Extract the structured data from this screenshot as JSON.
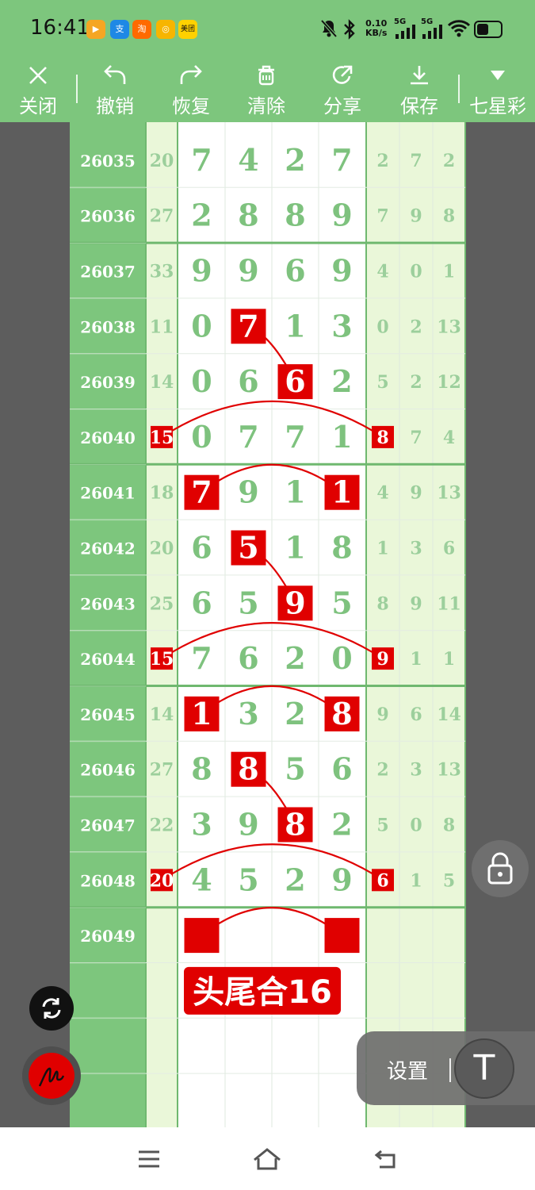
{
  "status": {
    "time": "16:41",
    "app_icons": [
      {
        "name": "video-app-icon",
        "text": "▶",
        "color": "#f5a623"
      },
      {
        "name": "alipay-app-icon",
        "text": "支",
        "color": "#1e88e5"
      },
      {
        "name": "taobao-app-icon",
        "text": "淘",
        "color": "#ff6a00"
      },
      {
        "name": "coin-app-icon",
        "text": "◎",
        "color": "#f7b500"
      },
      {
        "name": "meituan-app-icon",
        "text": "美团",
        "color": "#ffd100"
      }
    ],
    "net_speed_value": "0.10",
    "net_speed_unit": "KB/s",
    "signal_1": "5G",
    "signal_2": "5G"
  },
  "toolbar": {
    "close": "关闭",
    "undo": "撤销",
    "redo": "恢复",
    "clear": "清除",
    "share": "分享",
    "save": "保存",
    "lottery": "七星彩"
  },
  "chart": {
    "rows": [
      {
        "period": "26035",
        "sum": "20",
        "digits": [
          "7",
          "4",
          "2",
          "7"
        ],
        "tail": [
          "2",
          "7",
          "2"
        ]
      },
      {
        "period": "26036",
        "sum": "27",
        "digits": [
          "2",
          "8",
          "8",
          "9"
        ],
        "tail": [
          "7",
          "9",
          "8"
        ]
      },
      {
        "period": "26037",
        "sum": "33",
        "digits": [
          "9",
          "9",
          "6",
          "9"
        ],
        "tail": [
          "4",
          "0",
          "1"
        ]
      },
      {
        "period": "26038",
        "sum": "11",
        "digits": [
          "0",
          "7",
          "1",
          "3"
        ],
        "tail": [
          "0",
          "2",
          "13"
        ]
      },
      {
        "period": "26039",
        "sum": "14",
        "digits": [
          "0",
          "6",
          "6",
          "2"
        ],
        "tail": [
          "5",
          "2",
          "12"
        ]
      },
      {
        "period": "26040",
        "sum": "15",
        "digits": [
          "0",
          "7",
          "7",
          "1"
        ],
        "tail": [
          "8",
          "7",
          "4"
        ]
      },
      {
        "period": "26041",
        "sum": "18",
        "digits": [
          "7",
          "9",
          "1",
          "1"
        ],
        "tail": [
          "4",
          "9",
          "13"
        ]
      },
      {
        "period": "26042",
        "sum": "20",
        "digits": [
          "6",
          "5",
          "1",
          "8"
        ],
        "tail": [
          "1",
          "3",
          "6"
        ]
      },
      {
        "period": "26043",
        "sum": "25",
        "digits": [
          "6",
          "5",
          "9",
          "5"
        ],
        "tail": [
          "8",
          "9",
          "11"
        ]
      },
      {
        "period": "26044",
        "sum": "15",
        "digits": [
          "7",
          "6",
          "2",
          "0"
        ],
        "tail": [
          "9",
          "1",
          "1"
        ]
      },
      {
        "period": "26045",
        "sum": "14",
        "digits": [
          "1",
          "3",
          "2",
          "8"
        ],
        "tail": [
          "9",
          "6",
          "14"
        ]
      },
      {
        "period": "26046",
        "sum": "27",
        "digits": [
          "8",
          "8",
          "5",
          "6"
        ],
        "tail": [
          "2",
          "3",
          "13"
        ]
      },
      {
        "period": "26047",
        "sum": "22",
        "digits": [
          "3",
          "9",
          "8",
          "2"
        ],
        "tail": [
          "5",
          "0",
          "8"
        ]
      },
      {
        "period": "26048",
        "sum": "20",
        "digits": [
          "4",
          "5",
          "2",
          "9"
        ],
        "tail": [
          "6",
          "1",
          "5"
        ]
      },
      {
        "period": "26049",
        "sum": "",
        "digits": [
          "",
          "",
          "",
          ""
        ],
        "tail": [
          "",
          "",
          ""
        ]
      },
      {
        "period": "",
        "sum": "",
        "digits": [
          "",
          "",
          "",
          ""
        ],
        "tail": [
          "",
          "",
          ""
        ]
      },
      {
        "period": "",
        "sum": "",
        "digits": [
          "",
          "",
          "",
          ""
        ],
        "tail": [
          "",
          "",
          ""
        ]
      },
      {
        "period": "",
        "sum": "",
        "digits": [
          "",
          "",
          "",
          ""
        ],
        "tail": [
          "",
          "",
          ""
        ]
      }
    ],
    "highlight_cells": [
      {
        "row": 3,
        "col": "d1"
      },
      {
        "row": 4,
        "col": "d2"
      },
      {
        "row": 5,
        "col": "sum"
      },
      {
        "row": 5,
        "col": "t0"
      },
      {
        "row": 6,
        "col": "d0"
      },
      {
        "row": 6,
        "col": "d3"
      },
      {
        "row": 7,
        "col": "d1"
      },
      {
        "row": 8,
        "col": "d2"
      },
      {
        "row": 9,
        "col": "sum"
      },
      {
        "row": 9,
        "col": "t0"
      },
      {
        "row": 10,
        "col": "d0"
      },
      {
        "row": 10,
        "col": "d3"
      },
      {
        "row": 11,
        "col": "d1"
      },
      {
        "row": 12,
        "col": "d2"
      },
      {
        "row": 13,
        "col": "sum"
      },
      {
        "row": 13,
        "col": "t0"
      }
    ],
    "empty_markers": [
      {
        "row": 14,
        "col": "d0"
      },
      {
        "row": 14,
        "col": "d3"
      }
    ],
    "annotation": "头尾合16",
    "colors": {
      "accent_green": "#7dc67d",
      "light_green": "#eaf7d9",
      "digit_green": "#7ec27e",
      "mark_red": "#e00000"
    }
  },
  "floating": {
    "settings_label": "设置",
    "text_tool_label": "T"
  }
}
